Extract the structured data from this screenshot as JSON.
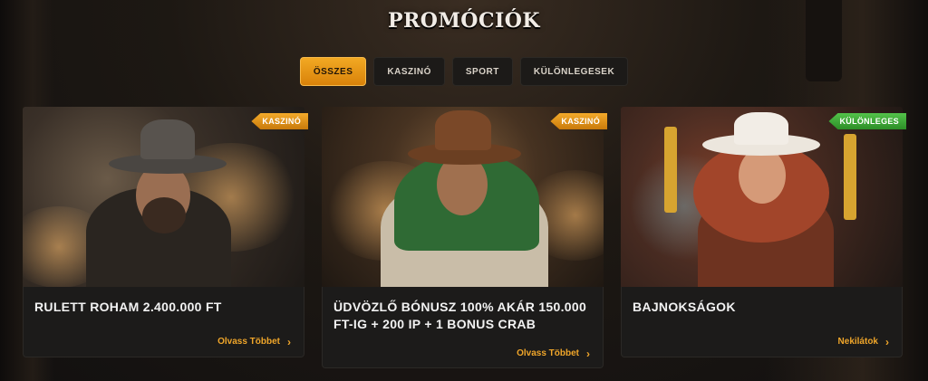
{
  "page": {
    "title": "PROMÓCIÓK"
  },
  "tabs": [
    {
      "label": "ÖSSZES",
      "active": true
    },
    {
      "label": "KASZINÓ",
      "active": false
    },
    {
      "label": "SPORT",
      "active": false
    },
    {
      "label": "KÜLÖNLEGESEK",
      "active": false
    }
  ],
  "cards": [
    {
      "tag": "KASZINÓ",
      "tag_color": "#e8960f",
      "title": "RULETT ROHAM 2.400.000 FT",
      "link": "Olvass Többet"
    },
    {
      "tag": "KASZINÓ",
      "tag_color": "#e8960f",
      "title": "ÜDVÖZLŐ BÓNUSZ 100% AKÁR 150.000 FT-IG + 200 IP + 1 BONUS CRAB",
      "link": "Olvass Többet"
    },
    {
      "tag": "KÜLÖNLEGES",
      "tag_color": "#3fae38",
      "title": "BAJNOKSÁGOK",
      "link": "Nekilátok"
    }
  ],
  "colors": {
    "accent": "#f0a62a",
    "tab_active": "#e8960f",
    "card_bg": "#1c1b1a",
    "page_bg": "#1d1813"
  },
  "icons": [
    "chevron-right-icon"
  ]
}
